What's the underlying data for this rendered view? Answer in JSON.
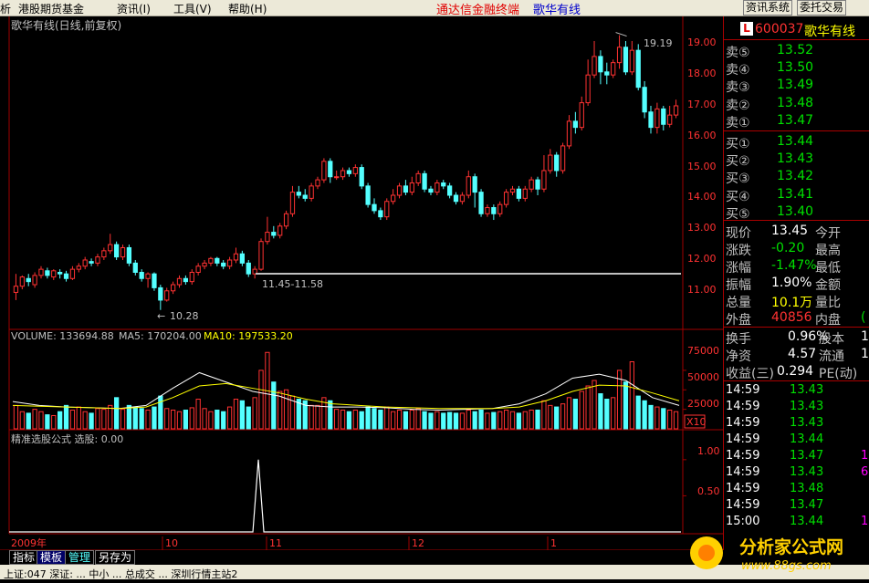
{
  "menu": {
    "items": [
      "析",
      "港股期货基金",
      "资讯(I)",
      "工具(V)",
      "帮助(H)"
    ],
    "title_red": "通达信金融终端",
    "title_blue": "歌华有线",
    "btn_info": "资讯系统",
    "btn_trade": "委托交易"
  },
  "chart": {
    "header": "歌华有线(日线,前复权)",
    "price_labels": [
      "19.00",
      "18.00",
      "17.00",
      "16.00",
      "15.00",
      "14.00",
      "13.00",
      "12.00",
      "11.00"
    ],
    "annot_high": "19.19",
    "annot_low": "10.28",
    "annot_range": "11.45-11.58",
    "volume_header": {
      "vol": "VOLUME: 133694.88",
      "ma5": "MA5: 170204.00",
      "ma10": "MA10: 197533.20"
    },
    "volume_labels": [
      "75000",
      "50000",
      "25000"
    ],
    "vol_unit": "X10",
    "indicator_header": "精准选股公式  选股: 0.00",
    "indicator_labels": [
      "1.00",
      "0.50"
    ],
    "x_labels": [
      "2009年",
      "10",
      "11",
      "12",
      "1"
    ],
    "colors": {
      "up": "#ff3232",
      "down": "#54ffff",
      "ma5": "#ffffff",
      "ma10": "#ffff00",
      "grid": "#a00000"
    }
  },
  "chart_data": {
    "type": "candlestick",
    "price_ylim": [
      10.0,
      19.5
    ],
    "candles": [
      [
        10.85,
        11.05,
        10.6,
        11.45
      ],
      [
        11.05,
        11.35,
        10.95,
        11.4
      ],
      [
        11.3,
        11.2,
        11.05,
        11.45
      ],
      [
        11.1,
        11.4,
        11.0,
        11.5
      ],
      [
        11.4,
        11.6,
        11.3,
        11.7
      ],
      [
        11.55,
        11.4,
        11.3,
        11.65
      ],
      [
        11.35,
        11.55,
        11.25,
        11.6
      ],
      [
        11.5,
        11.45,
        11.3,
        11.6
      ],
      [
        11.45,
        11.3,
        11.2,
        11.55
      ],
      [
        11.3,
        11.6,
        11.25,
        11.7
      ],
      [
        11.6,
        11.7,
        11.5,
        11.8
      ],
      [
        11.7,
        11.9,
        11.6,
        12.0
      ],
      [
        11.85,
        11.8,
        11.7,
        11.95
      ],
      [
        11.8,
        12.0,
        11.7,
        12.1
      ],
      [
        12.0,
        12.2,
        11.9,
        12.3
      ],
      [
        12.2,
        12.4,
        12.1,
        12.75
      ],
      [
        12.4,
        12.0,
        11.9,
        12.5
      ],
      [
        12.0,
        12.3,
        11.9,
        12.4
      ],
      [
        12.3,
        11.8,
        11.7,
        12.4
      ],
      [
        11.8,
        11.5,
        11.4,
        11.9
      ],
      [
        11.5,
        11.3,
        11.2,
        11.6
      ],
      [
        11.3,
        11.45,
        11.0,
        11.5
      ],
      [
        11.45,
        11.0,
        10.9,
        11.5
      ],
      [
        11.0,
        10.6,
        10.28,
        11.1
      ],
      [
        10.6,
        10.9,
        10.55,
        11.0
      ],
      [
        10.9,
        11.1,
        10.8,
        11.2
      ],
      [
        11.1,
        11.3,
        11.0,
        11.4
      ],
      [
        11.3,
        11.2,
        11.1,
        11.4
      ],
      [
        11.2,
        11.5,
        11.1,
        11.6
      ],
      [
        11.5,
        11.7,
        11.4,
        11.8
      ],
      [
        11.7,
        11.8,
        11.6,
        11.9
      ],
      [
        11.8,
        11.95,
        11.7,
        12.0
      ],
      [
        11.95,
        11.8,
        11.7,
        12.0
      ],
      [
        11.8,
        11.7,
        11.6,
        11.9
      ],
      [
        11.7,
        11.9,
        11.6,
        12.0
      ],
      [
        11.9,
        12.1,
        11.8,
        12.3
      ],
      [
        12.1,
        11.8,
        11.7,
        12.2
      ],
      [
        11.8,
        11.45,
        11.35,
        11.9
      ],
      [
        11.45,
        11.6,
        11.3,
        11.7
      ],
      [
        11.6,
        12.5,
        11.55,
        12.6
      ],
      [
        12.5,
        12.8,
        12.4,
        13.3
      ],
      [
        12.8,
        12.7,
        12.6,
        13.0
      ],
      [
        12.7,
        13.0,
        12.6,
        13.1
      ],
      [
        13.0,
        13.4,
        12.9,
        13.5
      ],
      [
        13.4,
        14.1,
        13.3,
        14.3
      ],
      [
        14.1,
        14.0,
        13.9,
        14.3
      ],
      [
        14.0,
        13.9,
        13.8,
        14.2
      ],
      [
        13.9,
        14.3,
        13.8,
        14.4
      ],
      [
        14.3,
        14.5,
        14.2,
        14.6
      ],
      [
        14.5,
        15.1,
        14.4,
        15.2
      ],
      [
        15.1,
        14.6,
        14.4,
        15.2
      ],
      [
        14.6,
        14.6,
        14.5,
        14.8
      ],
      [
        14.6,
        14.8,
        14.5,
        14.9
      ],
      [
        14.8,
        14.7,
        14.6,
        14.9
      ],
      [
        14.7,
        14.9,
        14.6,
        15.0
      ],
      [
        14.9,
        14.3,
        14.2,
        15.0
      ],
      [
        14.3,
        13.7,
        13.6,
        14.4
      ],
      [
        13.7,
        13.5,
        13.4,
        13.9
      ],
      [
        13.5,
        13.3,
        13.2,
        13.6
      ],
      [
        13.3,
        13.8,
        13.2,
        13.9
      ],
      [
        13.8,
        14.0,
        13.7,
        14.2
      ],
      [
        14.0,
        14.3,
        13.9,
        14.4
      ],
      [
        14.3,
        14.1,
        14.0,
        14.5
      ],
      [
        14.1,
        14.4,
        14.0,
        14.6
      ],
      [
        14.4,
        14.7,
        14.3,
        14.8
      ],
      [
        14.7,
        14.2,
        14.1,
        14.8
      ],
      [
        14.2,
        14.1,
        14.0,
        14.3
      ],
      [
        14.1,
        14.4,
        14.0,
        14.5
      ],
      [
        14.4,
        14.3,
        14.2,
        14.5
      ],
      [
        14.3,
        14.0,
        13.9,
        14.4
      ],
      [
        14.0,
        13.8,
        13.7,
        14.1
      ],
      [
        13.8,
        14.0,
        13.7,
        14.1
      ],
      [
        14.0,
        14.6,
        13.9,
        14.8
      ],
      [
        14.6,
        14.1,
        13.6,
        14.7
      ],
      [
        14.1,
        13.4,
        13.3,
        14.2
      ],
      [
        13.4,
        13.6,
        13.3,
        13.7
      ],
      [
        13.6,
        13.4,
        13.2,
        13.7
      ],
      [
        13.4,
        13.7,
        13.3,
        13.8
      ],
      [
        13.7,
        14.1,
        13.6,
        14.2
      ],
      [
        14.1,
        14.2,
        14.0,
        14.3
      ],
      [
        14.2,
        13.9,
        13.8,
        14.3
      ],
      [
        13.9,
        14.2,
        13.8,
        14.3
      ],
      [
        14.2,
        14.5,
        14.1,
        14.6
      ],
      [
        14.5,
        14.2,
        14.0,
        14.6
      ],
      [
        14.2,
        14.8,
        14.1,
        15.3
      ],
      [
        14.8,
        15.3,
        14.7,
        15.5
      ],
      [
        15.3,
        14.8,
        14.6,
        15.4
      ],
      [
        14.8,
        15.6,
        14.7,
        15.7
      ],
      [
        15.6,
        16.4,
        15.5,
        16.6
      ],
      [
        16.4,
        16.2,
        16.0,
        16.7
      ],
      [
        16.2,
        17.0,
        16.1,
        17.2
      ],
      [
        17.0,
        17.9,
        16.9,
        18.4
      ],
      [
        17.9,
        18.5,
        17.8,
        19.0
      ],
      [
        18.5,
        18.0,
        17.6,
        18.7
      ],
      [
        18.0,
        17.9,
        17.6,
        18.3
      ],
      [
        17.9,
        18.3,
        17.8,
        18.4
      ],
      [
        18.3,
        18.8,
        18.1,
        19.19
      ],
      [
        18.8,
        18.0,
        17.9,
        19.0
      ],
      [
        18.0,
        18.7,
        17.9,
        19.0
      ],
      [
        18.7,
        17.5,
        17.4,
        18.9
      ],
      [
        17.5,
        16.7,
        16.5,
        17.7
      ],
      [
        16.7,
        16.2,
        16.0,
        16.9
      ],
      [
        16.2,
        16.8,
        16.0,
        17.0
      ],
      [
        16.8,
        16.3,
        16.1,
        16.9
      ],
      [
        16.3,
        16.6,
        16.2,
        16.9
      ],
      [
        16.6,
        16.9,
        16.5,
        17.1
      ]
    ],
    "volume_ylim": [
      0,
      110000
    ],
    "volumes": [
      30000,
      22000,
      20000,
      25000,
      22000,
      18000,
      17000,
      22000,
      30000,
      24000,
      28000,
      22000,
      20000,
      26000,
      25000,
      30000,
      40000,
      25000,
      30000,
      28000,
      26000,
      24000,
      28000,
      42000,
      26000,
      24000,
      22000,
      24000,
      27000,
      38000,
      26000,
      22000,
      24000,
      22000,
      28000,
      38000,
      36000,
      28000,
      40000,
      75000,
      98000,
      60000,
      48000,
      50000,
      42000,
      38000,
      36000,
      30000,
      30000,
      40000,
      36000,
      25000,
      24000,
      22000,
      24000,
      22000,
      28000,
      26000,
      24000,
      28000,
      22000,
      24000,
      22000,
      24000,
      26000,
      22000,
      20000,
      22000,
      20000,
      21000,
      20000,
      20000,
      24000,
      22000,
      24000,
      20000,
      21000,
      22000,
      24000,
      22000,
      20000,
      22000,
      24000,
      24000,
      36000,
      30000,
      28000,
      32000,
      40000,
      38000,
      48000,
      55000,
      62000,
      45000,
      38000,
      40000,
      75000,
      60000,
      86000,
      42000,
      36000,
      30000,
      28000,
      26000,
      24000,
      22000
    ],
    "ma5_points": [
      35000,
      30000,
      28000,
      27000,
      26000,
      30000,
      52000,
      72000,
      60000,
      48000,
      42000,
      30000,
      28000,
      28000,
      27000,
      25000,
      24000,
      25000,
      26000,
      32000,
      45000,
      65000,
      70000,
      62000,
      40000,
      30000
    ],
    "ma10_points": [
      30000,
      29000,
      28000,
      27000,
      26000,
      28000,
      40000,
      55000,
      58000,
      52000,
      46000,
      38000,
      32000,
      30000,
      28000,
      27000,
      26000,
      26000,
      26000,
      28000,
      36000,
      48000,
      56000,
      55000,
      46000,
      36000
    ],
    "indicator": {
      "signal_index": 39,
      "value": 1.0,
      "ylim": [
        0,
        1.2
      ]
    }
  },
  "panel": {
    "code": "600037",
    "name": "歌华有线",
    "sell": [
      {
        "label": "卖⑤",
        "price": "13.52"
      },
      {
        "label": "卖④",
        "price": "13.50"
      },
      {
        "label": "卖③",
        "price": "13.49"
      },
      {
        "label": "卖②",
        "price": "13.48"
      },
      {
        "label": "卖①",
        "price": "13.47"
      }
    ],
    "buy": [
      {
        "label": "买①",
        "price": "13.44"
      },
      {
        "label": "买②",
        "price": "13.43"
      },
      {
        "label": "买③",
        "price": "13.42"
      },
      {
        "label": "买④",
        "price": "13.41"
      },
      {
        "label": "买⑤",
        "price": "13.40"
      }
    ],
    "quote": [
      {
        "l": "现价",
        "v": "13.45",
        "r": "今开",
        "vc": "#fff"
      },
      {
        "l": "涨跌",
        "v": "-0.20",
        "r": "最高",
        "vc": "#00e000"
      },
      {
        "l": "涨幅",
        "v": "-1.47%",
        "r": "最低",
        "vc": "#00e000"
      },
      {
        "l": "振幅",
        "v": "1.90%",
        "r": "金额",
        "vc": "#fff"
      },
      {
        "l": "总量",
        "v": "10.1万",
        "r": "量比",
        "vc": "#ffff00"
      },
      {
        "l": "外盘",
        "v": "40856",
        "r": "内盘",
        "vc": "#ff3232",
        "r2": "("
      }
    ],
    "stats": [
      {
        "l": "换手",
        "v": "0.96%",
        "r": "股本",
        "r2": "1"
      },
      {
        "l": "净资",
        "v": "4.57",
        "r": "流通",
        "r2": "1"
      },
      {
        "l": "收益(三)",
        "v": "0.294",
        "r": "PE(动)",
        "r2": ""
      }
    ],
    "ticks": [
      {
        "t": "14:59",
        "p": "13.43",
        "c": "#00e000",
        "e": ""
      },
      {
        "t": "14:59",
        "p": "13.43",
        "c": "#00e000",
        "e": ""
      },
      {
        "t": "14:59",
        "p": "13.43",
        "c": "#00e000",
        "e": ""
      },
      {
        "t": "14:59",
        "p": "13.44",
        "c": "#00e000",
        "e": ""
      },
      {
        "t": "14:59",
        "p": "13.47",
        "c": "#00e000",
        "e": "1"
      },
      {
        "t": "14:59",
        "p": "13.43",
        "c": "#00e000",
        "e": "6"
      },
      {
        "t": "14:59",
        "p": "13.48",
        "c": "#00e000",
        "e": ""
      },
      {
        "t": "14:59",
        "p": "13.47",
        "c": "#00e000",
        "e": ""
      },
      {
        "t": "15:00",
        "p": "13.44",
        "c": "#00e000",
        "e": "1"
      }
    ]
  },
  "tabs": [
    "指标",
    "模板",
    "管理",
    "另存为"
  ],
  "status": "上证:047  深证:  ...  中小  ...   总成交 ...  深圳行情主站2",
  "watermark": {
    "main": "分析家公式网",
    "sub": "www.88gs.com"
  }
}
